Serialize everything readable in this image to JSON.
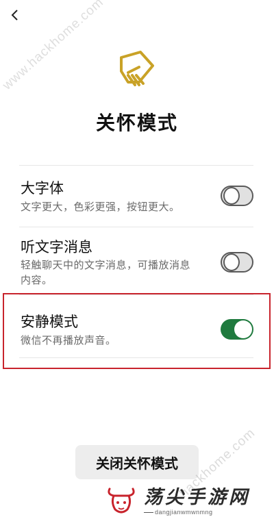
{
  "header": {
    "back_icon": "chevron-left-icon"
  },
  "watermarks": {
    "top": "www.hackhome.com",
    "middle": "hackhome.com"
  },
  "logo": {
    "icon": "care-hand-icon",
    "color": "#c9a227"
  },
  "page": {
    "title": "关怀模式"
  },
  "settings": [
    {
      "title": "大字体",
      "description": "文字更大，色彩更强，按钮更大。",
      "enabled": false
    },
    {
      "title": "听文字消息",
      "description": "轻触聊天中的文字消息，可播放消息内容。",
      "enabled": false
    },
    {
      "title": "安静模式",
      "description": "微信不再播放声音。",
      "enabled": true,
      "highlighted": true
    }
  ],
  "footer": {
    "close_label": "关闭关怀模式"
  },
  "site_badge": {
    "name": "荡尖手游网",
    "domain": "dangjianwmwnmng"
  },
  "colors": {
    "toggle_on": "#1f7a3e",
    "highlight_border": "#c8232c",
    "logo": "#c9a227"
  }
}
